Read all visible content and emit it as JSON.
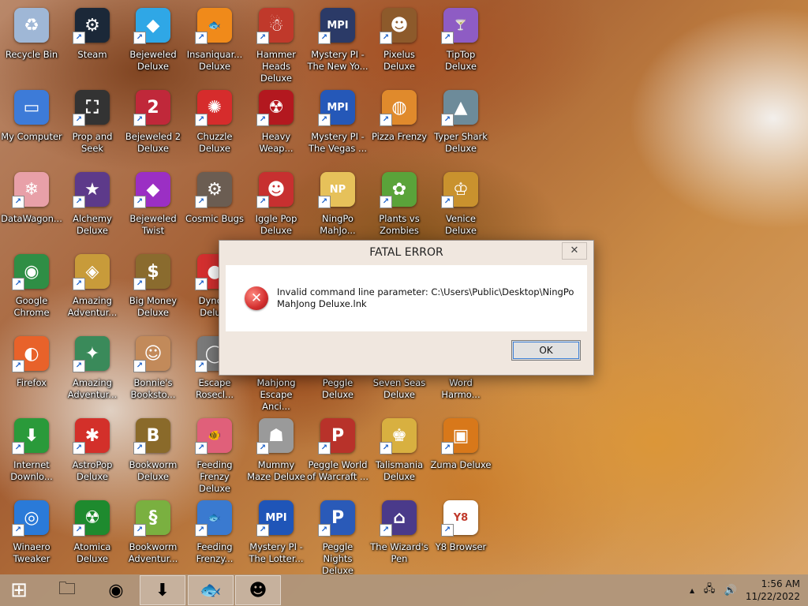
{
  "desktop": {
    "icons": [
      {
        "label": "Recycle Bin",
        "icon": "recycle-bin-icon",
        "color": "#9fb7d6",
        "glyph": "♻",
        "col": 0,
        "row": 0
      },
      {
        "label": "Steam",
        "icon": "steam-icon",
        "color": "#1b2838",
        "glyph": "⚙",
        "col": 1,
        "row": 0
      },
      {
        "label": "Bejeweled\nDeluxe",
        "icon": "diamond-icon",
        "color": "#2fa7e6",
        "glyph": "◆",
        "col": 2,
        "row": 0
      },
      {
        "label": "Insaniquar...\nDeluxe",
        "icon": "fish-icon",
        "color": "#f08a1a",
        "glyph": "🐟",
        "col": 3,
        "row": 0
      },
      {
        "label": "Hammer\nHeads Deluxe",
        "icon": "gnome-icon",
        "color": "#c0392b",
        "glyph": "☃",
        "col": 4,
        "row": 0
      },
      {
        "label": "Mystery PI -\nThe New Yo...",
        "icon": "mpi-logo-icon",
        "color": "#2b3a67",
        "glyph": "MPI",
        "col": 5,
        "row": 0
      },
      {
        "label": "Pixelus Deluxe",
        "icon": "explorer-character-icon",
        "color": "#8d5a2b",
        "glyph": "☻",
        "col": 6,
        "row": 0
      },
      {
        "label": "TipTop\nDeluxe",
        "icon": "cocktail-glass-icon",
        "color": "#8e5cc4",
        "glyph": "🍸",
        "col": 7,
        "row": 0
      },
      {
        "label": "My Computer",
        "icon": "computer-icon",
        "color": "#3d7bd8",
        "glyph": "▭",
        "col": 0,
        "row": 1
      },
      {
        "label": "Prop and\nSeek",
        "icon": "crane-icon",
        "color": "#333333",
        "glyph": "⛶",
        "col": 1,
        "row": 1
      },
      {
        "label": "Bejeweled 2\nDeluxe",
        "icon": "number-two-icon",
        "color": "#c0283a",
        "glyph": "2",
        "col": 2,
        "row": 1
      },
      {
        "label": "Chuzzle\nDeluxe",
        "icon": "fuzzball-icon",
        "color": "#d62c2c",
        "glyph": "✺",
        "col": 3,
        "row": 1
      },
      {
        "label": "Heavy\nWeap...",
        "icon": "radiation-icon",
        "color": "#b3181f",
        "glyph": "☢",
        "col": 4,
        "row": 1
      },
      {
        "label": "Mystery PI -\nThe Vegas ...",
        "icon": "mpi-logo-icon",
        "color": "#2558b8",
        "glyph": "MPI",
        "col": 5,
        "row": 1
      },
      {
        "label": "Pizza Frenzy",
        "icon": "pizza-icon",
        "color": "#e08a2c",
        "glyph": "◍",
        "col": 6,
        "row": 1
      },
      {
        "label": "Typer Shark\nDeluxe",
        "icon": "shark-icon",
        "color": "#6d8b9a",
        "glyph": "▲",
        "col": 7,
        "row": 1
      },
      {
        "label": "DataWagon...",
        "icon": "snowflake-icon",
        "color": "#e8a0a8",
        "glyph": "❄",
        "col": 0,
        "row": 2
      },
      {
        "label": "Alchemy\nDeluxe",
        "icon": "wizard-icon",
        "color": "#5d3a8a",
        "glyph": "★",
        "col": 1,
        "row": 2
      },
      {
        "label": "Bejeweled\nTwist",
        "icon": "gem-twist-icon",
        "color": "#9b2fc4",
        "glyph": "◆",
        "col": 2,
        "row": 2
      },
      {
        "label": "Cosmic Bugs",
        "icon": "gear-icon",
        "color": "#6b5d52",
        "glyph": "⚙",
        "col": 3,
        "row": 2
      },
      {
        "label": "Iggle Pop\nDeluxe",
        "icon": "iggle-creature-icon",
        "color": "#c73030",
        "glyph": "☻",
        "col": 4,
        "row": 2
      },
      {
        "label": "NingPo\nMahJo...",
        "icon": "mahjong-tile-icon",
        "color": "#e6c15a",
        "glyph": "NP",
        "col": 5,
        "row": 2
      },
      {
        "label": "Plants vs\nZombies",
        "icon": "plant-icon",
        "color": "#5aa33a",
        "glyph": "✿",
        "col": 6,
        "row": 2
      },
      {
        "label": "Venice Deluxe",
        "icon": "gondola-icon",
        "color": "#c9922e",
        "glyph": "♔",
        "col": 7,
        "row": 2
      },
      {
        "label": "Google\nChrome",
        "icon": "chrome-icon",
        "color": "#2f8e45",
        "glyph": "◉",
        "col": 0,
        "row": 3
      },
      {
        "label": "Amazing\nAdventur...",
        "icon": "diamond-badge-icon",
        "color": "#c89b3a",
        "glyph": "◈",
        "col": 1,
        "row": 3
      },
      {
        "label": "Big Money\nDeluxe",
        "icon": "money-bag-icon",
        "color": "#8a6b2e",
        "glyph": "$",
        "col": 2,
        "row": 3
      },
      {
        "label": "Dyno...\nDelu...",
        "icon": "mushroom-icon",
        "color": "#d32f2f",
        "glyph": "●",
        "col": 3,
        "row": 3
      },
      {
        "label": "Firefox",
        "icon": "firefox-icon",
        "color": "#e8622a",
        "glyph": "◐",
        "col": 0,
        "row": 4
      },
      {
        "label": "Amazing\nAdventur...",
        "icon": "compass-icon",
        "color": "#3a8a5a",
        "glyph": "✦",
        "col": 1,
        "row": 4
      },
      {
        "label": "Bonnie's\nBooksto...",
        "icon": "girl-icon",
        "color": "#c28a5a",
        "glyph": "☺",
        "col": 2,
        "row": 4
      },
      {
        "label": "Escape\nRosecl...",
        "icon": "ring-icon",
        "color": "#7a7a7a",
        "glyph": "◯",
        "col": 3,
        "row": 4
      },
      {
        "label": "Mahjong\nEscape Anci...",
        "icon": "mahjong-escape-icon",
        "color": "#a0522d",
        "glyph": "▦",
        "col": 4,
        "row": 4
      },
      {
        "label": "Peggle Deluxe",
        "icon": "peggle-icon",
        "color": "#e0702a",
        "glyph": "P",
        "col": 5,
        "row": 4
      },
      {
        "label": "Seven Seas\nDeluxe",
        "icon": "ship-icon",
        "color": "#3a6ea5",
        "glyph": "⛵",
        "col": 6,
        "row": 4
      },
      {
        "label": "Word\nHarmo...",
        "icon": "word-harmony-icon",
        "color": "#8a4a2a",
        "glyph": "W",
        "col": 7,
        "row": 4
      },
      {
        "label": "Internet\nDownlo...",
        "icon": "internet-download-manager-icon",
        "color": "#2a9a3a",
        "glyph": "⬇",
        "col": 0,
        "row": 5
      },
      {
        "label": "AstroPop\nDeluxe",
        "icon": "astropop-icon",
        "color": "#d3302a",
        "glyph": "✱",
        "col": 1,
        "row": 5
      },
      {
        "label": "Bookworm\nDeluxe",
        "icon": "book-icon",
        "color": "#8a6a2a",
        "glyph": "B",
        "col": 2,
        "row": 5
      },
      {
        "label": "Feeding\nFrenzy Deluxe",
        "icon": "fish-icon",
        "color": "#e0607a",
        "glyph": "🐠",
        "col": 3,
        "row": 5
      },
      {
        "label": "Mummy\nMaze Deluxe",
        "icon": "mummy-icon",
        "color": "#9a9a9a",
        "glyph": "☗",
        "col": 4,
        "row": 5
      },
      {
        "label": "Peggle World\nof Warcraft ...",
        "icon": "peggle-wow-icon",
        "color": "#b8322a",
        "glyph": "P",
        "col": 5,
        "row": 5
      },
      {
        "label": "Talismania\nDeluxe",
        "icon": "king-icon",
        "color": "#d8b040",
        "glyph": "♚",
        "col": 6,
        "row": 5
      },
      {
        "label": "Zuma Deluxe",
        "icon": "zuma-idol-icon",
        "color": "#d8781a",
        "glyph": "▣",
        "col": 7,
        "row": 5
      },
      {
        "label": "Winaero\nTweaker",
        "icon": "winaero-icon",
        "color": "#2a7ad8",
        "glyph": "◎",
        "col": 0,
        "row": 6
      },
      {
        "label": "Atomica\nDeluxe",
        "icon": "atomica-icon",
        "color": "#1e8a2e",
        "glyph": "☢",
        "col": 1,
        "row": 6
      },
      {
        "label": "Bookworm\nAdventur...",
        "icon": "worm-icon",
        "color": "#7ab040",
        "glyph": "§",
        "col": 2,
        "row": 6
      },
      {
        "label": "Feeding\nFrenzy...",
        "icon": "fish-icon",
        "color": "#3a7ad0",
        "glyph": "🐟",
        "col": 3,
        "row": 6
      },
      {
        "label": "Mystery PI -\nThe Lotter...",
        "icon": "mpi-logo-icon",
        "color": "#1f55b8",
        "glyph": "MPI",
        "col": 4,
        "row": 6
      },
      {
        "label": "Peggle Nights\nDeluxe",
        "icon": "peggle-nights-icon",
        "color": "#2a5ab8",
        "glyph": "P",
        "col": 5,
        "row": 6
      },
      {
        "label": "The Wizard's\nPen",
        "icon": "wizard-pen-icon",
        "color": "#4a3a8a",
        "glyph": "⌂",
        "col": 6,
        "row": 6
      },
      {
        "label": "Y8 Browser",
        "icon": "y8-browser-icon",
        "color": "#ffffff",
        "glyph": "Y8",
        "col": 7,
        "row": 6
      }
    ]
  },
  "dialog": {
    "title": "FATAL ERROR",
    "close_glyph": "✕",
    "error_glyph": "✕",
    "message": "Invalid command line parameter: C:\\Users\\Public\\Desktop\\NingPo MahJong Deluxe.lnk",
    "ok_label": "OK"
  },
  "taskbar": {
    "start_glyph": "⊞",
    "pinned": [
      {
        "name": "file-explorer-taskbar-button",
        "icon": "folder-icon",
        "glyph": "🗀",
        "active": false
      },
      {
        "name": "chrome-taskbar-button",
        "icon": "chrome-icon",
        "glyph": "◉",
        "active": false
      },
      {
        "name": "internet-download-manager-taskbar-button",
        "icon": "internet-download-manager-icon",
        "glyph": "⬇",
        "active": true
      },
      {
        "name": "insaniquarium-taskbar-button",
        "icon": "fish-icon",
        "glyph": "🐟",
        "active": true
      },
      {
        "name": "pixelus-taskbar-button",
        "icon": "explorer-character-icon",
        "glyph": "☻",
        "active": true
      }
    ],
    "tray": {
      "chevron_glyph": "▲",
      "network_glyph": "🖧",
      "volume_glyph": "🔊"
    },
    "clock": {
      "time": "1:56 AM",
      "date": "11/22/2022"
    }
  }
}
